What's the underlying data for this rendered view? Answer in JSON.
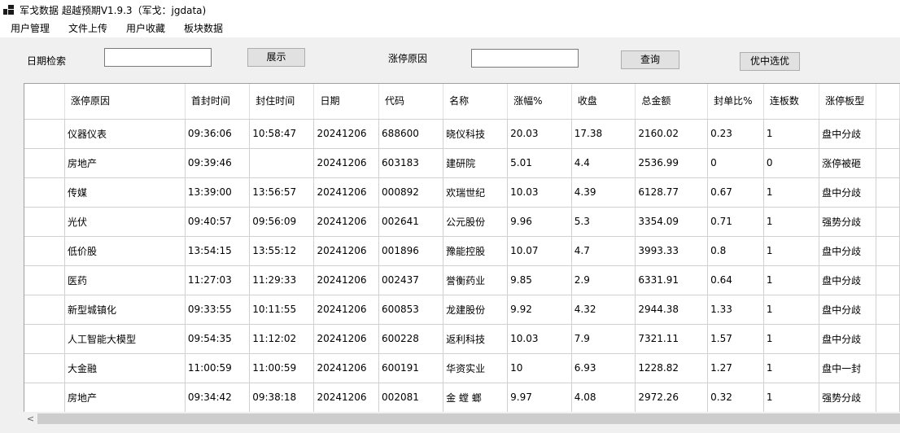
{
  "window": {
    "title": "军戈数据 超越预期V1.9.3（军戈：jgdata)",
    "icon": "app-grid-icon"
  },
  "menu": [
    {
      "label": "用户管理"
    },
    {
      "label": "文件上传"
    },
    {
      "label": "用户收藏"
    },
    {
      "label": "板块数据"
    }
  ],
  "toolbar": {
    "date_label": "日期检索",
    "date_value": "",
    "show_button": "展示",
    "reason_label": "涨停原因",
    "reason_value": "",
    "query_button": "查询",
    "select_button": "优中选优"
  },
  "table": {
    "columns": [
      "涨停原因",
      "首封时间",
      "封住时间",
      "日期",
      "代码",
      "名称",
      "涨幅%",
      "收盘",
      "总金额",
      "封单比%",
      "连板数",
      "涨停板型"
    ],
    "rows": [
      [
        "仪器仪表",
        "09:36:06",
        "10:58:47",
        "20241206",
        "688600",
        "晓仪科技",
        "20.03",
        "17.38",
        "2160.02",
        "0.23",
        "1",
        "盘中分歧"
      ],
      [
        "房地产",
        "09:39:46",
        "",
        "20241206",
        "603183",
        "建研院",
        "5.01",
        "4.4",
        "2536.99",
        "0",
        "0",
        "涨停被砸"
      ],
      [
        "传媒",
        "13:39:00",
        "13:56:57",
        "20241206",
        "000892",
        "欢瑞世纪",
        "10.03",
        "4.39",
        "6128.77",
        "0.67",
        "1",
        "盘中分歧"
      ],
      [
        "光伏",
        "09:40:57",
        "09:56:09",
        "20241206",
        "002641",
        "公元股份",
        "9.96",
        "5.3",
        "3354.09",
        "0.71",
        "1",
        "强势分歧"
      ],
      [
        "低价股",
        "13:54:15",
        "13:55:12",
        "20241206",
        "001896",
        "豫能控股",
        "10.07",
        "4.7",
        "3993.33",
        "0.8",
        "1",
        "盘中分歧"
      ],
      [
        "医药",
        "11:27:03",
        "11:29:33",
        "20241206",
        "002437",
        "誉衡药业",
        "9.85",
        "2.9",
        "6331.91",
        "0.64",
        "1",
        "盘中分歧"
      ],
      [
        "新型城镇化",
        "09:33:55",
        "10:11:55",
        "20241206",
        "600853",
        "龙建股份",
        "9.92",
        "4.32",
        "2944.38",
        "1.33",
        "1",
        "盘中分歧"
      ],
      [
        "人工智能大模型",
        "09:54:35",
        "11:12:02",
        "20241206",
        "600228",
        "返利科技",
        "10.03",
        "7.9",
        "7321.11",
        "1.57",
        "1",
        "盘中分歧"
      ],
      [
        "大金融",
        "11:00:59",
        "11:00:59",
        "20241206",
        "600191",
        "华资实业",
        "10",
        "6.93",
        "1228.82",
        "1.27",
        "1",
        "盘中一封"
      ],
      [
        "房地产",
        "09:34:42",
        "09:38:18",
        "20241206",
        "002081",
        "金 螳 螂",
        "9.97",
        "4.08",
        "2972.26",
        "0.32",
        "1",
        "强势分歧"
      ]
    ]
  },
  "scrollbar": {
    "left_arrow": "<"
  }
}
